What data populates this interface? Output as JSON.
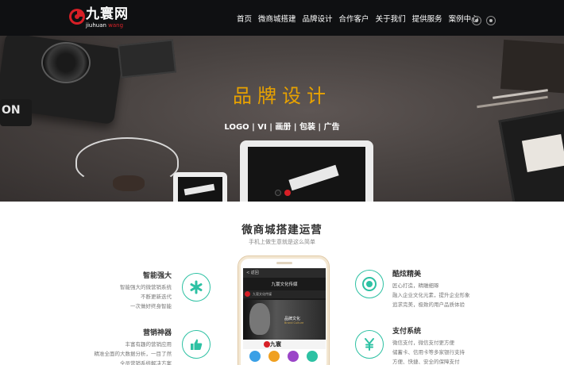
{
  "header": {
    "logo": {
      "name_cn": "九寰网",
      "name_en_white": "jiuhuan",
      "name_en_red": "wang"
    },
    "nav": [
      "首页",
      "微商城搭建",
      "品牌设计",
      "合作客户",
      "关于我们",
      "提供服务",
      "案例中心"
    ],
    "icons": [
      "qq-icon",
      "wechat-icon"
    ]
  },
  "banner": {
    "title": "品牌设计",
    "subtitle": "LOGO | VI | 画册 | 包装 | 广告",
    "slides": 2,
    "active_slide": 2,
    "props": {
      "strap_text": "ON"
    }
  },
  "services": {
    "title": "微商城搭建运营",
    "subtitle": "手机上做生意就是这么简单",
    "features_left": [
      {
        "title": "智能强大",
        "desc": [
          "智能强大的微营销系统",
          "不断更新迭代",
          "一次做好终身智能"
        ],
        "icon": "asterisk-icon"
      },
      {
        "title": "营销神器",
        "desc": [
          "丰富有趣的营销应用",
          "精准全面的大数据分析，一目了然",
          "全员营销系统解决方案"
        ],
        "icon": "thumbs-up-icon"
      }
    ],
    "features_right": [
      {
        "title": "酷炫精美",
        "desc": [
          "匠心打造，精雕细琢",
          "融入企业文化元素，提升企业形象",
          "追求完美，极致的用户品质体验"
        ],
        "icon": "target-icon"
      },
      {
        "title": "支付系统",
        "desc": [
          "微信支付，微信支付更方便",
          "储蓄卡、信用卡等多家银行支持",
          "方便、快捷、安全的保障支付"
        ],
        "icon": "yuan-icon"
      }
    ],
    "accent": "#2dc1a3"
  },
  "mockup": {
    "back": "< 返回",
    "title": "九寰文化传媒",
    "bar_text": "九寰文化传媒",
    "brand_line": "品牌文化",
    "brand_line2": "Brand Culture",
    "footer_logo": "九寰",
    "icon_colors": [
      "#3aa0e6",
      "#f0a020",
      "#9b45c8",
      "#2dc1a3"
    ]
  }
}
